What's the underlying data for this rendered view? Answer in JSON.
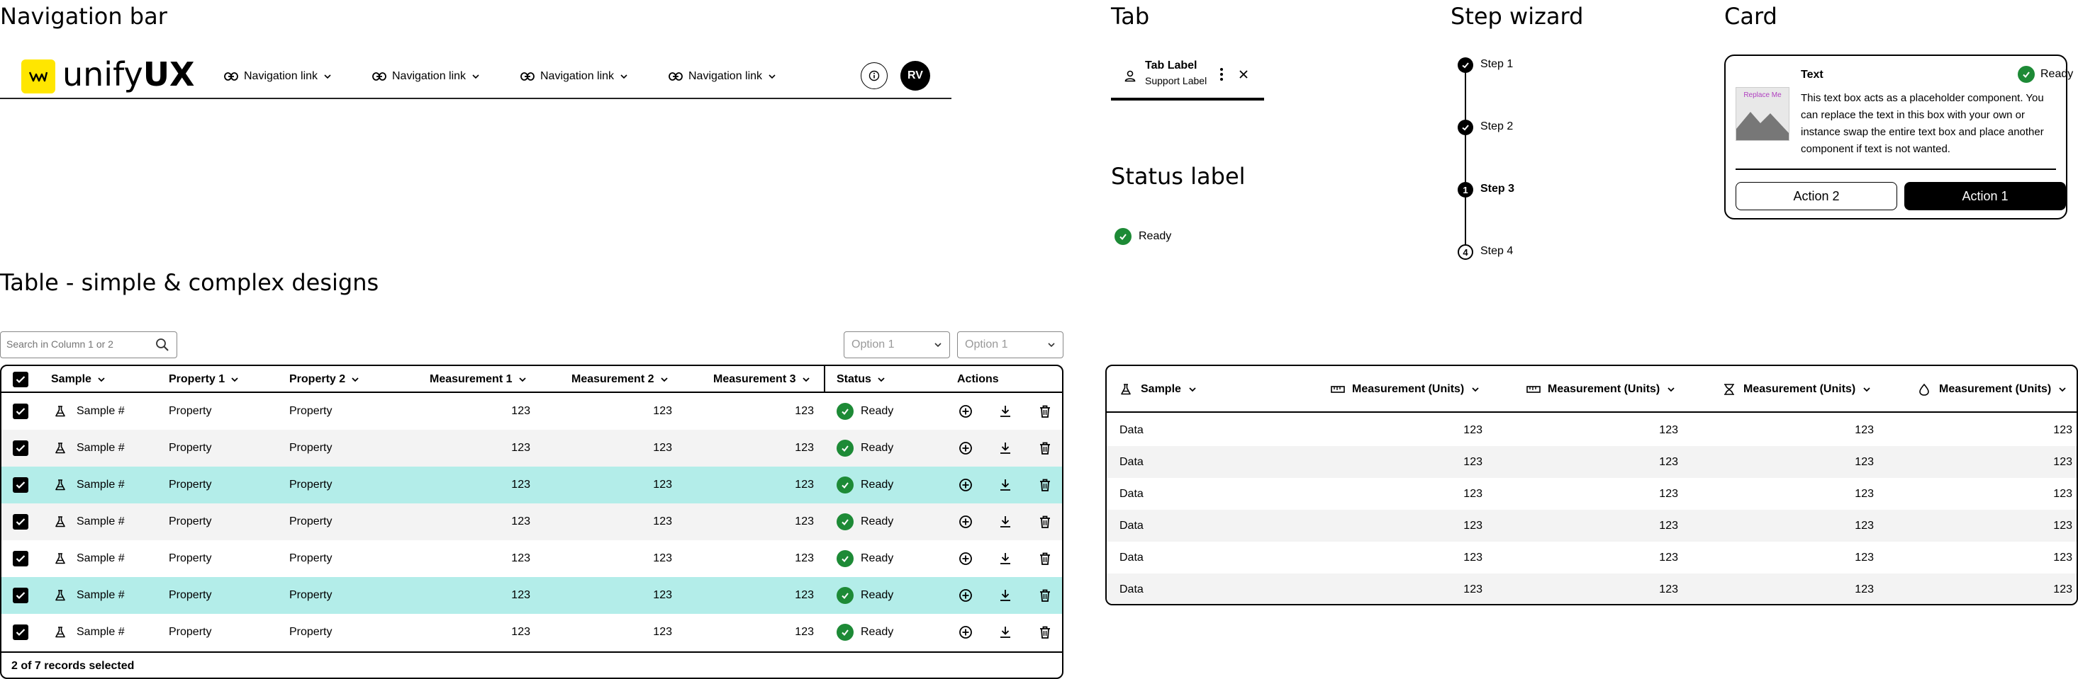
{
  "sections": {
    "nav": "Navigation bar",
    "tab": "Tab",
    "step": "Step wizard",
    "card": "Card",
    "status": "Status label",
    "table": "Table - simple & complex designs"
  },
  "nav": {
    "logo_light": "unify",
    "logo_bold": "UX",
    "links": [
      "Navigation link",
      "Navigation link",
      "Navigation link",
      "Navigation link"
    ],
    "avatar": "RV"
  },
  "tab": {
    "label": "Tab Label",
    "support": "Support Label"
  },
  "steps": [
    {
      "label": "Step 1",
      "state": "done"
    },
    {
      "label": "Step 2",
      "state": "done"
    },
    {
      "label": "Step 3",
      "state": "active",
      "number": "1"
    },
    {
      "label": "Step 4",
      "state": "todo",
      "number": "4"
    }
  ],
  "card": {
    "image_text": "Replace Me",
    "title": "Text",
    "status": "Ready",
    "body": "This text box acts as a placeholder component. You can replace the text in this box with your own or instance swap the entire text box and place another component if text is not wanted.",
    "action2": "Action 2",
    "action1": "Action 1"
  },
  "status_label": {
    "text": "Ready",
    "color": "#1d8a36"
  },
  "table1": {
    "search_placeholder": "Search in Column 1 or 2",
    "select1": "Option 1",
    "select2": "Option 1",
    "columns": [
      "Sample",
      "Property 1",
      "Property 2",
      "Measurement 1",
      "Measurement 2",
      "Measurement 3",
      "Status",
      "Actions"
    ],
    "rows": [
      {
        "sample": "Sample #",
        "p1": "Property",
        "p2": "Property",
        "m1": "123",
        "m2": "123",
        "m3": "123",
        "status": "Ready",
        "style": "plain"
      },
      {
        "sample": "Sample #",
        "p1": "Property",
        "p2": "Property",
        "m1": "123",
        "m2": "123",
        "m3": "123",
        "status": "Ready",
        "style": "alt"
      },
      {
        "sample": "Sample #",
        "p1": "Property",
        "p2": "Property",
        "m1": "123",
        "m2": "123",
        "m3": "123",
        "status": "Ready",
        "style": "selected"
      },
      {
        "sample": "Sample #",
        "p1": "Property",
        "p2": "Property",
        "m1": "123",
        "m2": "123",
        "m3": "123",
        "status": "Ready",
        "style": "alt"
      },
      {
        "sample": "Sample #",
        "p1": "Property",
        "p2": "Property",
        "m1": "123",
        "m2": "123",
        "m3": "123",
        "status": "Ready",
        "style": "plain"
      },
      {
        "sample": "Sample #",
        "p1": "Property",
        "p2": "Property",
        "m1": "123",
        "m2": "123",
        "m3": "123",
        "status": "Ready",
        "style": "selected"
      },
      {
        "sample": "Sample #",
        "p1": "Property",
        "p2": "Property",
        "m1": "123",
        "m2": "123",
        "m3": "123",
        "status": "Ready",
        "style": "plain"
      }
    ],
    "footer": "2 of 7 records selected",
    "selected_color": "#b3ede9"
  },
  "table2": {
    "columns": [
      {
        "label": "Sample",
        "icon": "flask-icon"
      },
      {
        "label": "Measurement (Units)",
        "icon": "ruler-icon"
      },
      {
        "label": "Measurement (Units)",
        "icon": "ruler-icon"
      },
      {
        "label": "Measurement (Units)",
        "icon": "hourglass-icon"
      },
      {
        "label": "Measurement (Units)",
        "icon": "drop-icon"
      }
    ],
    "rows": [
      [
        "Data",
        "123",
        "123",
        "123",
        "123"
      ],
      [
        "Data",
        "123",
        "123",
        "123",
        "123"
      ],
      [
        "Data",
        "123",
        "123",
        "123",
        "123"
      ],
      [
        "Data",
        "123",
        "123",
        "123",
        "123"
      ],
      [
        "Data",
        "123",
        "123",
        "123",
        "123"
      ],
      [
        "Data",
        "123",
        "123",
        "123",
        "123"
      ]
    ]
  },
  "colors": {
    "brand_yellow": "#ffe600",
    "ready_green": "#1d8a36",
    "row_alt": "#f3f3f3"
  }
}
